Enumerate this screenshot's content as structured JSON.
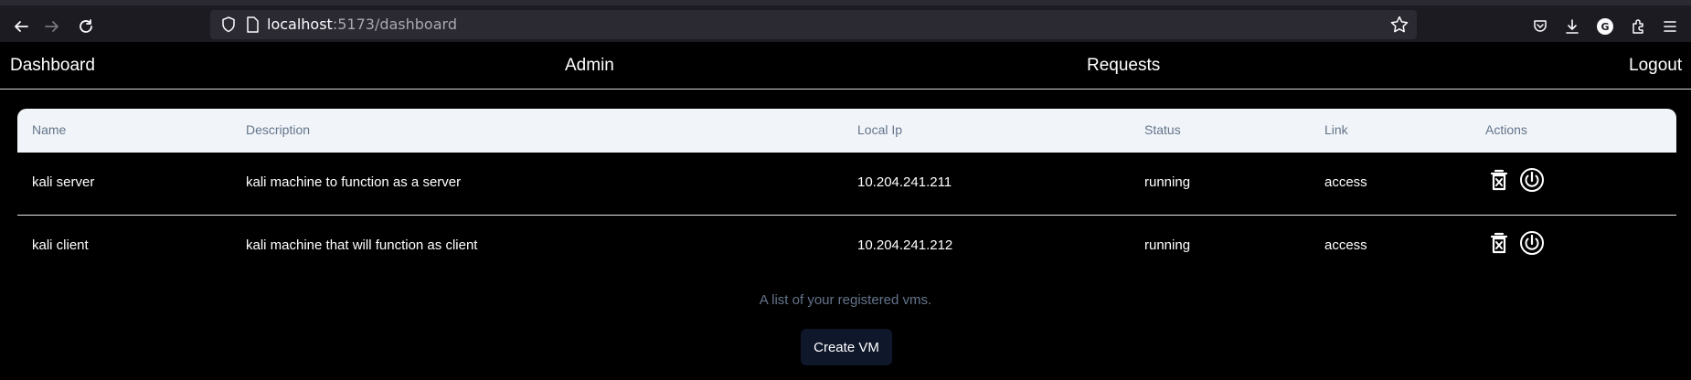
{
  "browser": {
    "url_host": "localhost",
    "url_rest": ":5173/dashboard",
    "profile_initial": "G"
  },
  "nav": {
    "dashboard": "Dashboard",
    "admin": "Admin",
    "requests": "Requests",
    "logout": "Logout"
  },
  "table": {
    "headers": [
      "Name",
      "Description",
      "Local Ip",
      "Status",
      "Link",
      "Actions"
    ],
    "rows": [
      {
        "name": "kali server",
        "description": "kali machine to function as a server",
        "local_ip": "10.204.241.211",
        "status": "running",
        "link": "access"
      },
      {
        "name": "kali client",
        "description": "kali machine that will function as client",
        "local_ip": "10.204.241.212",
        "status": "running",
        "link": "access"
      }
    ],
    "caption": "A list of your registered vms."
  },
  "create_button": "Create VM",
  "colors": {
    "background": "#000000",
    "header_bg": "#f1f5f9",
    "muted_text": "#64748b",
    "button_bg": "#0f172a"
  },
  "icons": [
    "back-icon",
    "forward-icon",
    "reload-icon",
    "shield-icon",
    "page-icon",
    "star-icon",
    "pocket-icon",
    "download-icon",
    "extensions-icon",
    "menu-icon",
    "trash-icon",
    "power-icon"
  ]
}
